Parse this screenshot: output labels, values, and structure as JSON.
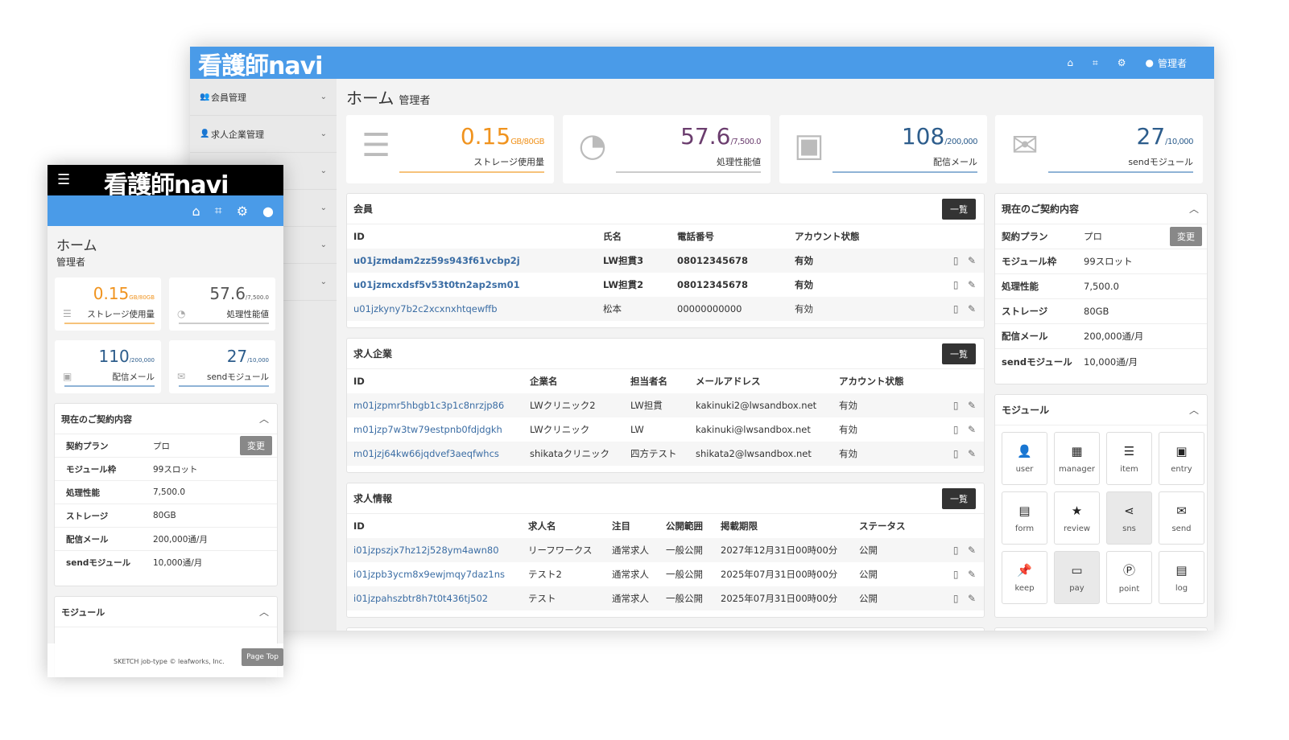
{
  "desktop": {
    "logo": "看護師navi",
    "topbar": {
      "home_icon": "⌂",
      "book_icon": "⌗",
      "gear_icon": "⚙",
      "user_label": "管理者"
    },
    "sidebar": [
      {
        "label": "会員管理",
        "icon": "people"
      },
      {
        "label": "求人企業管理",
        "icon": "person"
      },
      {
        "label": "",
        "icon": ""
      },
      {
        "label": "",
        "icon": ""
      },
      {
        "label": "",
        "icon": ""
      },
      {
        "label": "",
        "icon": ""
      }
    ],
    "title": "ホーム",
    "subtitle": "管理者",
    "stats": [
      {
        "value": "0.15",
        "unit": "GB/80GB",
        "label": "ストレージ使用量",
        "color": "#f0931e",
        "icon": "storage-icon"
      },
      {
        "value": "57.6",
        "unit": "/7,500.0",
        "label": "処理性能値",
        "color": "#6b3d6e",
        "icon": "gauge-icon"
      },
      {
        "value": "108",
        "unit": "/200,000",
        "label": "配信メール",
        "color": "#2d5d8c",
        "icon": "inbox-icon"
      },
      {
        "value": "27",
        "unit": "/10,000",
        "label": "sendモジュール",
        "color": "#2d5d8c",
        "icon": "mail-icon"
      }
    ],
    "members": {
      "title": "会員",
      "list_button": "一覧",
      "headers": [
        "ID",
        "氏名",
        "電話番号",
        "アカウント状態"
      ],
      "rows": [
        {
          "id": "u01jzmdam2zz59s943f61vcbp2j",
          "name": "LW担貫3",
          "phone": "08012345678",
          "status": "有効"
        },
        {
          "id": "u01jzmcxdsf5v53t0tn2ap2sm01",
          "name": "LW担貫2",
          "phone": "08012345678",
          "status": "有効"
        },
        {
          "id": "u01jzkyny7b2c2xcxnxhtqewffb",
          "name": "松本",
          "phone": "00000000000",
          "status": "有効"
        }
      ]
    },
    "companies": {
      "title": "求人企業",
      "list_button": "一覧",
      "headers": [
        "ID",
        "企業名",
        "担当者名",
        "メールアドレス",
        "アカウント状態"
      ],
      "rows": [
        {
          "id": "m01jzpmr5hbgb1c3p1c8nrzjp86",
          "company": "LWクリニック2",
          "person": "LW担貫",
          "email": "kakinuki2@lwsandbox.net",
          "status": "有効"
        },
        {
          "id": "m01jzp7w3tw79estpnb0fdjdgkh",
          "company": "LWクリニック",
          "person": "LW",
          "email": "kakinuki@lwsandbox.net",
          "status": "有効"
        },
        {
          "id": "m01jzj64kw66jqdvef3aeqfwhcs",
          "company": "shikataクリニック",
          "person": "四方テスト",
          "email": "shikata2@lwsandbox.net",
          "status": "有効"
        }
      ]
    },
    "jobs": {
      "title": "求人情報",
      "list_button": "一覧",
      "headers": [
        "ID",
        "求人名",
        "注目",
        "公開範囲",
        "掲載期限",
        "ステータス"
      ],
      "rows": [
        {
          "id": "i01jzpszjx7hz12j528ym4awn80",
          "name": "リーフワークス",
          "focus": "通常求人",
          "scope": "一般公開",
          "deadline": "2027年12月31日00時00分",
          "status": "公開"
        },
        {
          "id": "i01jzpb3ycm8x9ewjmqy7daz1ns",
          "name": "テスト2",
          "focus": "通常求人",
          "scope": "一般公開",
          "deadline": "2025年07月31日00時00分",
          "status": "公開"
        },
        {
          "id": "i01jzpahszbtr8h7t0t436tj502",
          "name": "テスト",
          "focus": "通常求人",
          "scope": "一般公開",
          "deadline": "2025年07月31日00時00分",
          "status": "公開"
        }
      ]
    },
    "contract": {
      "title": "現在のご契約内容",
      "change_button": "変更",
      "rows": [
        {
          "k": "契約プラン",
          "v": "プロ"
        },
        {
          "k": "モジュール枠",
          "v": "99スロット"
        },
        {
          "k": "処理性能",
          "v": "7,500.0"
        },
        {
          "k": "ストレージ",
          "v": "80GB"
        },
        {
          "k": "配信メール",
          "v": "200,000通/月"
        },
        {
          "k": "sendモジュール",
          "v": "10,000通/月"
        }
      ]
    },
    "modules": {
      "title": "モジュール",
      "items": [
        {
          "label": "user",
          "glyph": "👤"
        },
        {
          "label": "manager",
          "glyph": "▦"
        },
        {
          "label": "item",
          "glyph": "☰"
        },
        {
          "label": "entry",
          "glyph": "▣"
        },
        {
          "label": "form",
          "glyph": "▤"
        },
        {
          "label": "review",
          "glyph": "★"
        },
        {
          "label": "sns",
          "glyph": "⋖"
        },
        {
          "label": "send",
          "glyph": "✉"
        },
        {
          "label": "keep",
          "glyph": "📌"
        },
        {
          "label": "pay",
          "glyph": "▭"
        },
        {
          "label": "point",
          "glyph": "Ⓟ"
        },
        {
          "label": "log",
          "glyph": "▤"
        }
      ]
    }
  },
  "mobile": {
    "logo": "看護師navi",
    "title": "ホーム",
    "subtitle": "管理者",
    "stats": [
      {
        "value": "0.15",
        "unit": "GB/80GB",
        "label": "ストレージ使用量",
        "color": "#f0931e"
      },
      {
        "value": "57.6",
        "unit": "/7,500.0",
        "label": "処理性能値",
        "color": "#555555"
      },
      {
        "value": "110",
        "unit": "/200,000",
        "label": "配信メール",
        "color": "#2d5d8c"
      },
      {
        "value": "27",
        "unit": "/10,000",
        "label": "sendモジュール",
        "color": "#2d5d8c"
      }
    ],
    "contract_title": "現在のご契約内容",
    "change_button": "変更",
    "contract_rows": [
      {
        "k": "契約プラン",
        "v": "プロ"
      },
      {
        "k": "モジュール枠",
        "v": "99スロット"
      },
      {
        "k": "処理性能",
        "v": "7,500.0"
      },
      {
        "k": "ストレージ",
        "v": "80GB"
      },
      {
        "k": "配信メール",
        "v": "200,000通/月"
      },
      {
        "k": "sendモジュール",
        "v": "10,000通/月"
      }
    ],
    "modules_title": "モジュール",
    "footer_copy": "SKETCH job-type © leafworks, Inc.",
    "page_top": "Page Top"
  }
}
